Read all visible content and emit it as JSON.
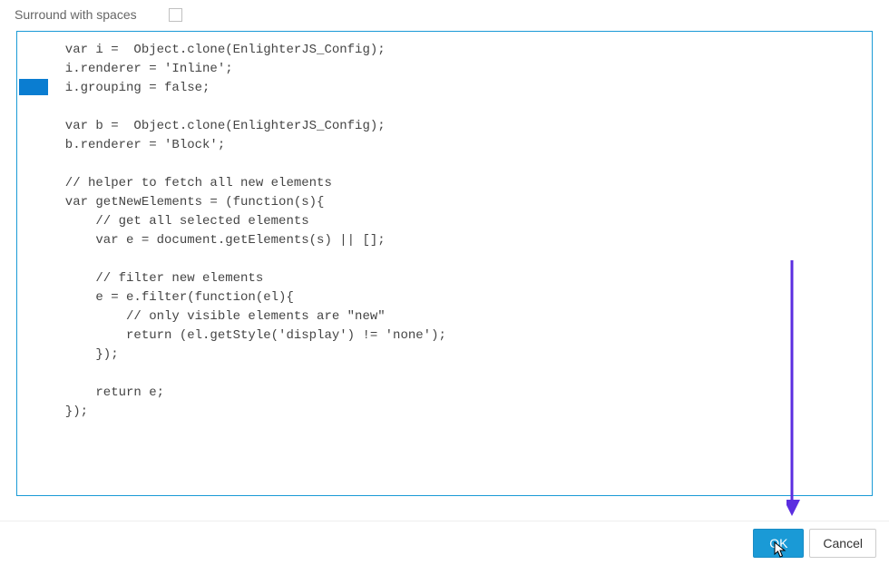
{
  "topRow": {
    "label": "Surround with spaces",
    "checked": false
  },
  "code": {
    "lines": [
      "  var i =  Object.clone(EnlighterJS_Config);",
      "  i.renderer = 'Inline';",
      "  i.grouping = false;",
      "",
      "  var b =  Object.clone(EnlighterJS_Config);",
      "  b.renderer = 'Block';",
      "",
      "  // helper to fetch all new elements",
      "  var getNewElements = (function(s){",
      "      // get all selected elements",
      "      var e = document.getElements(s) || [];",
      "",
      "      // filter new elements",
      "      e = e.filter(function(el){",
      "          // only visible elements are \"new\"",
      "          return (el.getStyle('display') != 'none');",
      "      });",
      "",
      "      return e;",
      "  });"
    ]
  },
  "arrow": {
    "color": "#5b2ee0"
  },
  "footer": {
    "ok_label": "OK",
    "cancel_label": "Cancel"
  }
}
